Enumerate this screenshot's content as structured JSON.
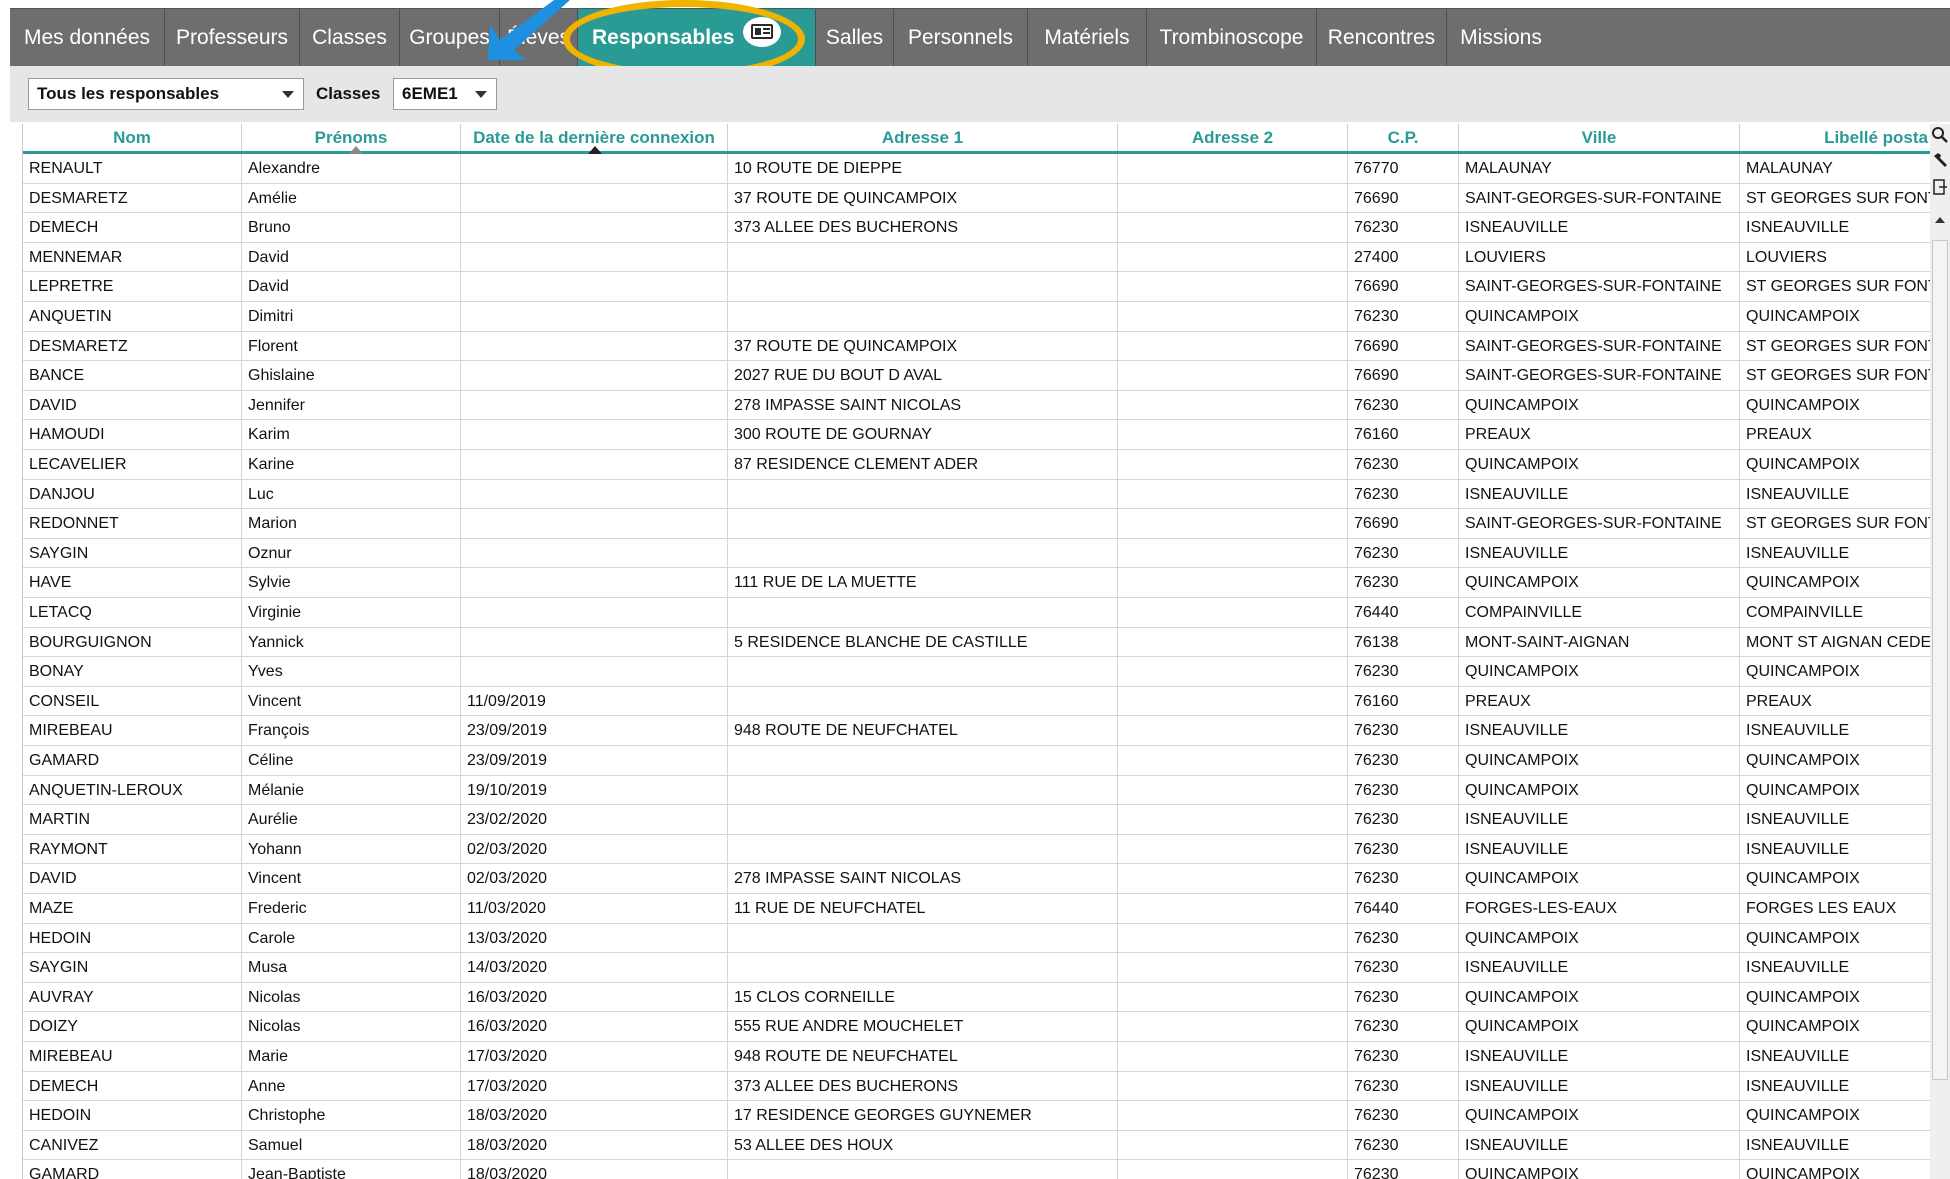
{
  "tabs": [
    {
      "label": "Mes données",
      "active": false
    },
    {
      "label": "Professeurs",
      "active": false
    },
    {
      "label": "Classes",
      "active": false
    },
    {
      "label": "Groupes",
      "active": false
    },
    {
      "label": "Élèves",
      "active": false
    },
    {
      "label": "Responsables",
      "active": true
    },
    {
      "label": "Salles",
      "active": false
    },
    {
      "label": "Personnels",
      "active": false
    },
    {
      "label": "Matériels",
      "active": false
    },
    {
      "label": "Trombinoscope",
      "active": false
    },
    {
      "label": "Rencontres",
      "active": false
    },
    {
      "label": "Missions",
      "active": false
    }
  ],
  "filters": {
    "responsables_select": "Tous les responsables",
    "classes_label": "Classes",
    "classes_select": "6EME1"
  },
  "table": {
    "headers": [
      "Nom",
      "Prénoms",
      "Date de la dernière connexion",
      "Adresse 1",
      "Adresse 2",
      "C.P.",
      "Ville",
      "Libellé posta"
    ],
    "rows": [
      [
        "RENAULT",
        "Alexandre",
        "",
        "10 ROUTE DE DIEPPE",
        "",
        "76770",
        "MALAUNAY",
        "MALAUNAY"
      ],
      [
        "DESMARETZ",
        "Amélie",
        "",
        "37 ROUTE DE QUINCAMPOIX",
        "",
        "76690",
        "SAINT-GEORGES-SUR-FONTAINE",
        "ST GEORGES SUR FONT"
      ],
      [
        "DEMECH",
        "Bruno",
        "",
        "373 ALLEE DES BUCHERONS",
        "",
        "76230",
        "ISNEAUVILLE",
        "ISNEAUVILLE"
      ],
      [
        "MENNEMAR",
        "David",
        "",
        "",
        "",
        "27400",
        "LOUVIERS",
        "LOUVIERS"
      ],
      [
        "LEPRETRE",
        "David",
        "",
        "",
        "",
        "76690",
        "SAINT-GEORGES-SUR-FONTAINE",
        "ST GEORGES SUR FONT"
      ],
      [
        "ANQUETIN",
        "Dimitri",
        "",
        "",
        "",
        "76230",
        "QUINCAMPOIX",
        "QUINCAMPOIX"
      ],
      [
        "DESMARETZ",
        "Florent",
        "",
        "37 ROUTE DE QUINCAMPOIX",
        "",
        "76690",
        "SAINT-GEORGES-SUR-FONTAINE",
        "ST GEORGES SUR FONT"
      ],
      [
        "BANCE",
        "Ghislaine",
        "",
        "2027 RUE DU BOUT D AVAL",
        "",
        "76690",
        "SAINT-GEORGES-SUR-FONTAINE",
        "ST GEORGES SUR FONT"
      ],
      [
        "DAVID",
        "Jennifer",
        "",
        "278 IMPASSE SAINT NICOLAS",
        "",
        "76230",
        "QUINCAMPOIX",
        "QUINCAMPOIX"
      ],
      [
        "HAMOUDI",
        "Karim",
        "",
        "300 ROUTE DE GOURNAY",
        "",
        "76160",
        "PREAUX",
        "PREAUX"
      ],
      [
        "LECAVELIER",
        "Karine",
        "",
        "87 RESIDENCE CLEMENT ADER",
        "",
        "76230",
        "QUINCAMPOIX",
        "QUINCAMPOIX"
      ],
      [
        "DANJOU",
        "Luc",
        "",
        "",
        "",
        "76230",
        "ISNEAUVILLE",
        "ISNEAUVILLE"
      ],
      [
        "REDONNET",
        "Marion",
        "",
        "",
        "",
        "76690",
        "SAINT-GEORGES-SUR-FONTAINE",
        "ST GEORGES SUR FONT"
      ],
      [
        "SAYGIN",
        "Oznur",
        "",
        "",
        "",
        "76230",
        "ISNEAUVILLE",
        "ISNEAUVILLE"
      ],
      [
        "HAVE",
        "Sylvie",
        "",
        "111 RUE DE LA MUETTE",
        "",
        "76230",
        "QUINCAMPOIX",
        "QUINCAMPOIX"
      ],
      [
        "LETACQ",
        "Virginie",
        "",
        "",
        "",
        "76440",
        "COMPAINVILLE",
        "COMPAINVILLE"
      ],
      [
        "BOURGUIGNON",
        "Yannick",
        "",
        "5 RESIDENCE BLANCHE DE CASTILLE",
        "",
        "76138",
        "MONT-SAINT-AIGNAN",
        "MONT ST AIGNAN CEDE"
      ],
      [
        "BONAY",
        "Yves",
        "",
        "",
        "",
        "76230",
        "QUINCAMPOIX",
        "QUINCAMPOIX"
      ],
      [
        "CONSEIL",
        "Vincent",
        "11/09/2019",
        "",
        "",
        "76160",
        "PREAUX",
        "PREAUX"
      ],
      [
        "MIREBEAU",
        "François",
        "23/09/2019",
        "948 ROUTE DE NEUFCHATEL",
        "",
        "76230",
        "ISNEAUVILLE",
        "ISNEAUVILLE"
      ],
      [
        "GAMARD",
        "Céline",
        "23/09/2019",
        "",
        "",
        "76230",
        "QUINCAMPOIX",
        "QUINCAMPOIX"
      ],
      [
        "ANQUETIN-LEROUX",
        "Mélanie",
        "19/10/2019",
        "",
        "",
        "76230",
        "QUINCAMPOIX",
        "QUINCAMPOIX"
      ],
      [
        "MARTIN",
        "Aurélie",
        "23/02/2020",
        "",
        "",
        "76230",
        "ISNEAUVILLE",
        "ISNEAUVILLE"
      ],
      [
        "RAYMONT",
        "Yohann",
        "02/03/2020",
        "",
        "",
        "76230",
        "ISNEAUVILLE",
        "ISNEAUVILLE"
      ],
      [
        "DAVID",
        "Vincent",
        "02/03/2020",
        "278 IMPASSE SAINT NICOLAS",
        "",
        "76230",
        "QUINCAMPOIX",
        "QUINCAMPOIX"
      ],
      [
        "MAZE",
        "Frederic",
        "11/03/2020",
        "11 RUE DE NEUFCHATEL",
        "",
        "76440",
        "FORGES-LES-EAUX",
        "FORGES LES EAUX"
      ],
      [
        "HEDOIN",
        "Carole",
        "13/03/2020",
        "",
        "",
        "76230",
        "QUINCAMPOIX",
        "QUINCAMPOIX"
      ],
      [
        "SAYGIN",
        "Musa",
        "14/03/2020",
        "",
        "",
        "76230",
        "ISNEAUVILLE",
        "ISNEAUVILLE"
      ],
      [
        "AUVRAY",
        "Nicolas",
        "16/03/2020",
        "15 CLOS CORNEILLE",
        "",
        "76230",
        "QUINCAMPOIX",
        "QUINCAMPOIX"
      ],
      [
        "DOIZY",
        "Nicolas",
        "16/03/2020",
        "555 RUE ANDRE MOUCHELET",
        "",
        "76230",
        "QUINCAMPOIX",
        "QUINCAMPOIX"
      ],
      [
        "MIREBEAU",
        "Marie",
        "17/03/2020",
        "948 ROUTE DE NEUFCHATEL",
        "",
        "76230",
        "ISNEAUVILLE",
        "ISNEAUVILLE"
      ],
      [
        "DEMECH",
        "Anne",
        "17/03/2020",
        "373 ALLEE DES BUCHERONS",
        "",
        "76230",
        "ISNEAUVILLE",
        "ISNEAUVILLE"
      ],
      [
        "HEDOIN",
        "Christophe",
        "18/03/2020",
        "17 RESIDENCE GEORGES GUYNEMER",
        "",
        "76230",
        "QUINCAMPOIX",
        "QUINCAMPOIX"
      ],
      [
        "CANIVEZ",
        "Samuel",
        "18/03/2020",
        "53 ALLEE DES HOUX",
        "",
        "76230",
        "ISNEAUVILLE",
        "ISNEAUVILLE"
      ],
      [
        "GAMARD",
        "Jean-Baptiste",
        "18/03/2020",
        "",
        "",
        "76230",
        "QUINCAMPOIX",
        "QUINCAMPOIX"
      ]
    ]
  },
  "colors": {
    "accent": "#2a9a94",
    "tabbar": "#6e6e6e",
    "highlight_ring": "#f0b400",
    "pointer_arrow": "#1e90e0"
  },
  "icons": [
    "card-icon",
    "search-icon",
    "wrench-icon",
    "export-icon",
    "scroll-up-icon"
  ]
}
